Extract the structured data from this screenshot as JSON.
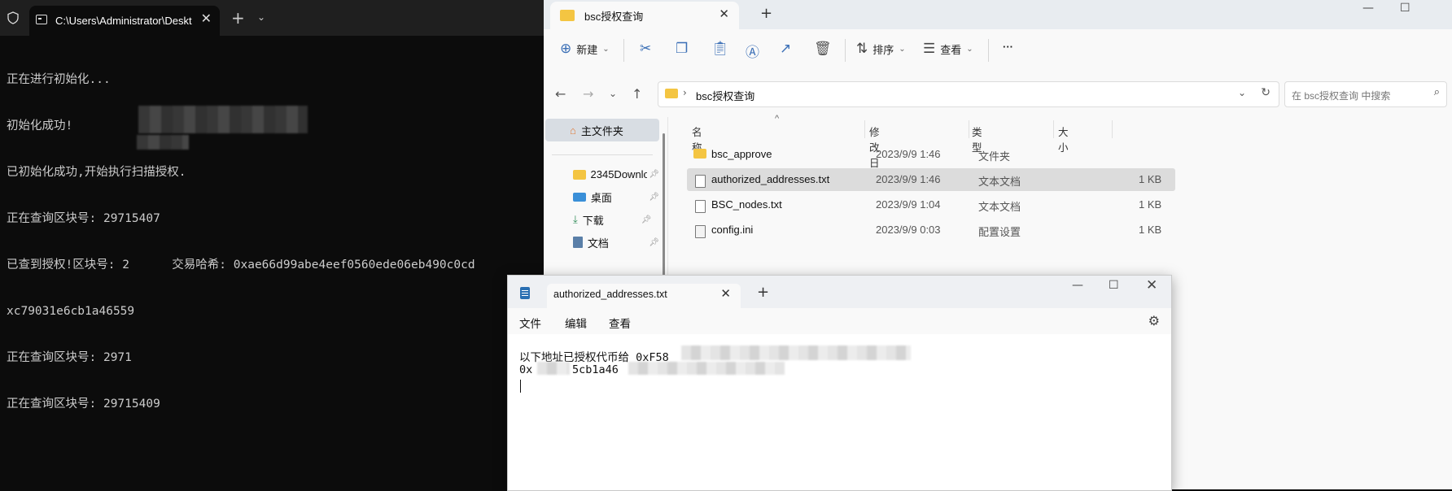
{
  "terminal": {
    "tab_title": "C:\\Users\\Administrator\\Deskt",
    "lines": [
      "正在进行初始化...",
      "初始化成功!",
      "已初始化成功,开始执行扫描授权.",
      "正在查询区块号: 29715407",
      "已查到授权!区块号: 2      交易哈希: 0xae66d99abe4eef0560ede06eb490c0cd",
      "xc79031e6cb1a46559",
      "正在查询区块号: 2971",
      "正在查询区块号: 29715409"
    ]
  },
  "explorer": {
    "tab_title": "bsc授权查询",
    "toolbar": {
      "new_label": "新建",
      "sort_label": "排序",
      "view_label": "查看",
      "more_label": "···"
    },
    "address": "bsc授权查询",
    "search_placeholder": "在 bsc授权查询 中搜索",
    "sidebar": [
      {
        "label": "主文件夹"
      },
      {
        "label": "2345Downlo"
      },
      {
        "label": "桌面"
      },
      {
        "label": "下载"
      },
      {
        "label": "文档"
      }
    ],
    "columns": {
      "name": "名称",
      "date": "修改日期",
      "type": "类型",
      "size": "大小"
    },
    "files": [
      {
        "name": "bsc_approve",
        "date": "2023/9/9 1:46",
        "type": "文件夹",
        "size": "",
        "kind": "folder"
      },
      {
        "name": "authorized_addresses.txt",
        "date": "2023/9/9 1:46",
        "type": "文本文档",
        "size": "1 KB",
        "kind": "doc"
      },
      {
        "name": "BSC_nodes.txt",
        "date": "2023/9/9 1:04",
        "type": "文本文档",
        "size": "1 KB",
        "kind": "doc"
      },
      {
        "name": "config.ini",
        "date": "2023/9/9 0:03",
        "type": "配置设置",
        "size": "1 KB",
        "kind": "ini"
      }
    ]
  },
  "notepad": {
    "tab_title": "authorized_addresses.txt",
    "menu": {
      "file": "文件",
      "edit": "编辑",
      "view": "查看"
    },
    "line1": "以下地址已授权代币给 0xF58",
    "line2": "0x      5cb1a46"
  }
}
